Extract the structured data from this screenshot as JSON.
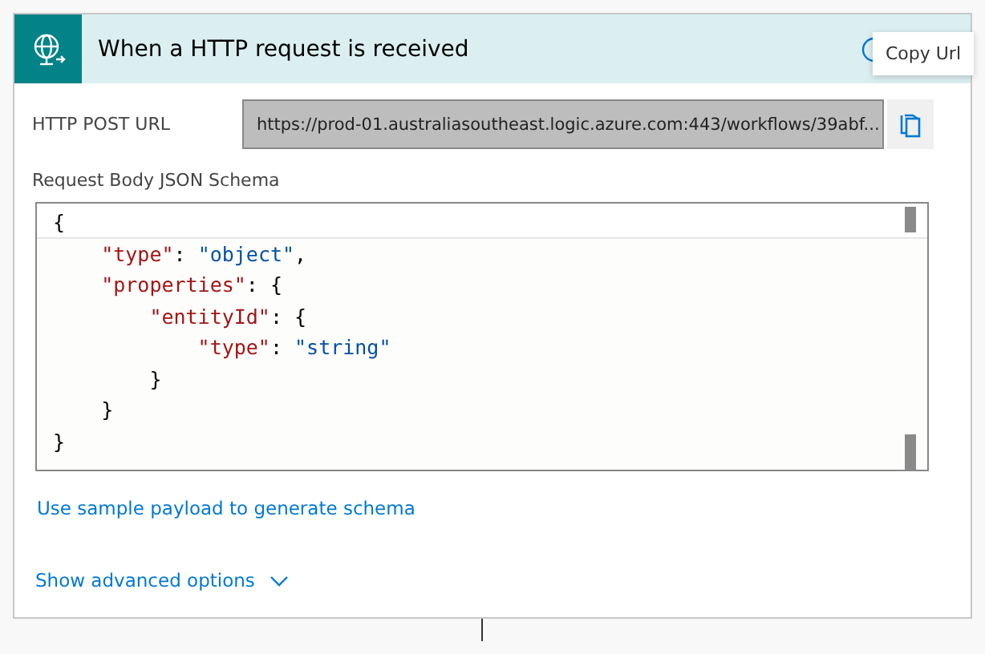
{
  "header": {
    "title": "When a HTTP request is received"
  },
  "tooltip": {
    "text": "Copy Url"
  },
  "url_field": {
    "label": "HTTP POST URL",
    "value": "https://prod-01.australiasoutheast.logic.azure.com:443/workflows/39abf..."
  },
  "schema": {
    "label": "Request Body JSON Schema",
    "lines": [
      [
        {
          "kind": "punct",
          "text": "{"
        }
      ],
      [
        {
          "kind": "key",
          "text": "    \"type\""
        },
        {
          "kind": "punct",
          "text": ": "
        },
        {
          "kind": "string",
          "text": "\"object\""
        },
        {
          "kind": "punct",
          "text": ","
        }
      ],
      [
        {
          "kind": "key",
          "text": "    \"properties\""
        },
        {
          "kind": "punct",
          "text": ": {"
        }
      ],
      [
        {
          "kind": "key",
          "text": "        \"entityId\""
        },
        {
          "kind": "punct",
          "text": ": {"
        }
      ],
      [
        {
          "kind": "key",
          "text": "            \"type\""
        },
        {
          "kind": "punct",
          "text": ": "
        },
        {
          "kind": "string",
          "text": "\"string\""
        }
      ],
      [
        {
          "kind": "punct",
          "text": "        }"
        }
      ],
      [
        {
          "kind": "punct",
          "text": "    }"
        }
      ],
      [
        {
          "kind": "punct",
          "text": "}"
        }
      ]
    ]
  },
  "sample_link": "Use sample payload to generate schema",
  "advanced_link": "Show advanced options"
}
